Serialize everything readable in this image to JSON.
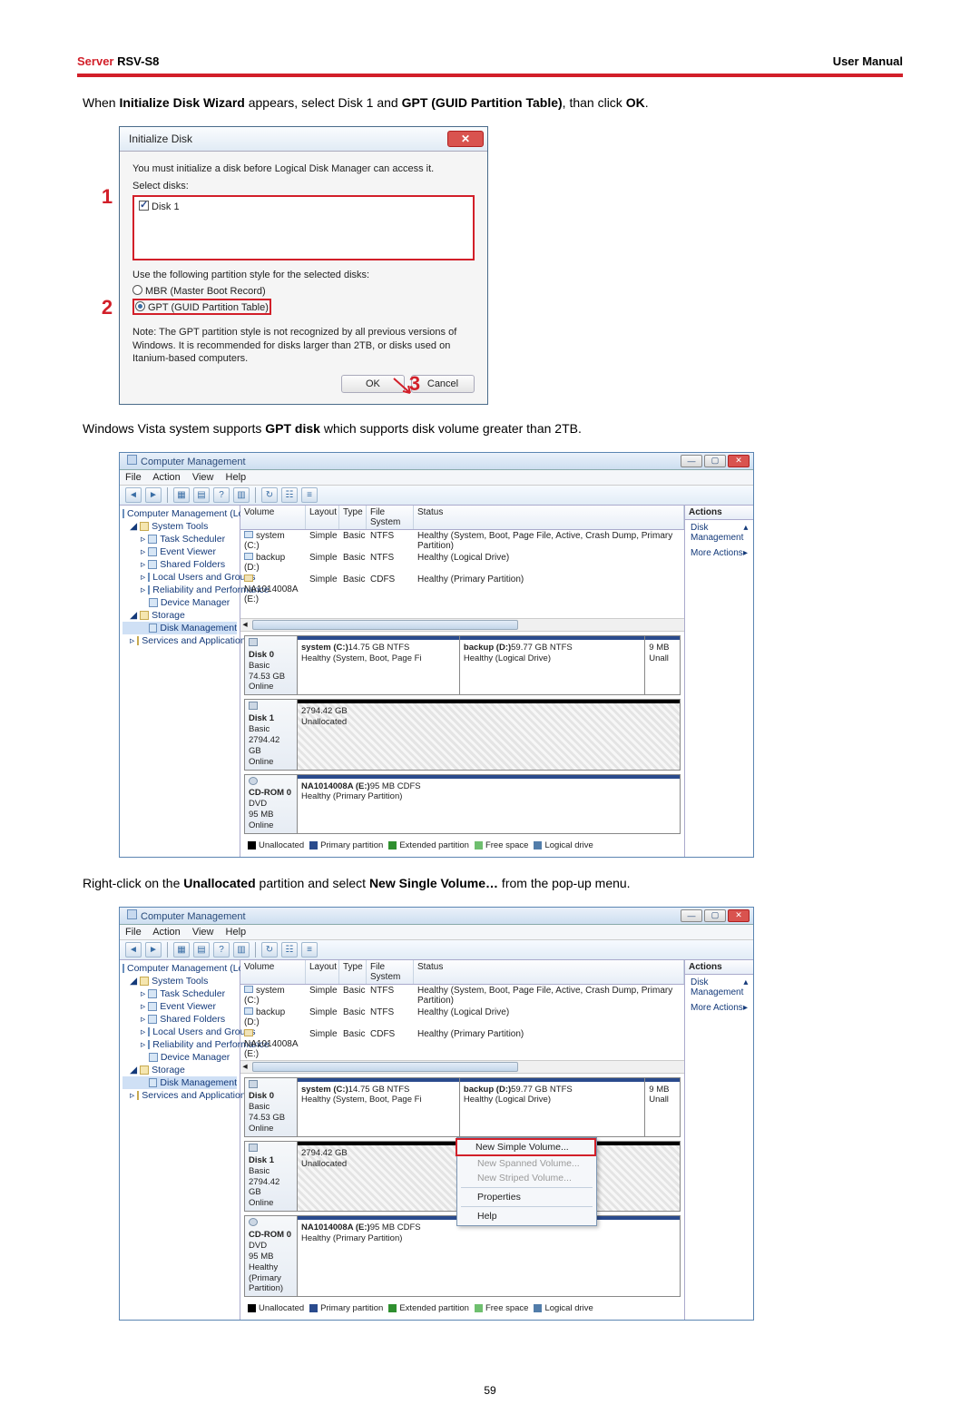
{
  "header": {
    "server": "Server",
    "model": "RSV-S8",
    "right": "User Manual"
  },
  "page_num": "59",
  "para1": {
    "pre": "When ",
    "b1": "Initialize Disk Wizard",
    "mid1": " appears, select Disk 1 and ",
    "b2": "GPT (GUID Partition Table)",
    "mid2": ", than click ",
    "b3": "OK",
    "end": "."
  },
  "dialog": {
    "title": "Initialize Disk",
    "line1": "You must initialize a disk before Logical Disk Manager can access it.",
    "line2": "Select disks:",
    "disk1": "Disk 1",
    "line3": "Use the following partition style for the selected disks:",
    "opt_mbr": "MBR (Master Boot Record)",
    "opt_gpt": "GPT (GUID Partition Table)",
    "note": "Note: The GPT partition style is not recognized by all previous versions of Windows. It is recommended for disks larger than 2TB, or disks used on Itanium-based computers.",
    "ok": "OK",
    "cancel": "Cancel",
    "callouts": {
      "c1": "1",
      "c2": "2",
      "c3": "3"
    }
  },
  "para2": {
    "pre": "Windows Vista system supports ",
    "b1": "GPT disk",
    "post": " which supports disk volume greater than 2TB."
  },
  "para3": {
    "pre": "Right-click on the ",
    "b1": "Unallocated",
    "mid": " partition and select ",
    "b2": "New Single Volume…",
    "post": " from the pop-up menu."
  },
  "mmc": {
    "title": "Computer Management",
    "menu": [
      "File",
      "Action",
      "View",
      "Help"
    ],
    "tree": {
      "root": "Computer Management (Local)",
      "system_tools": "System Tools",
      "items_sys": [
        "Task Scheduler",
        "Event Viewer",
        "Shared Folders",
        "Local Users and Groups",
        "Reliability and Performance",
        "Device Manager"
      ],
      "storage": "Storage",
      "disk_mgmt": "Disk Management",
      "services": "Services and Applications"
    },
    "vol_headers": {
      "volume": "Volume",
      "layout": "Layout",
      "type": "Type",
      "fs": "File System",
      "status": "Status"
    },
    "volumes": [
      {
        "name": "system (C:)",
        "layout": "Simple",
        "type": "Basic",
        "fs": "NTFS",
        "status": "Healthy (System, Boot, Page File, Active, Crash Dump, Primary Partition)"
      },
      {
        "name": "backup (D:)",
        "layout": "Simple",
        "type": "Basic",
        "fs": "NTFS",
        "status": "Healthy (Logical Drive)"
      },
      {
        "name": "NA1014008A (E:)",
        "layout": "Simple",
        "type": "Basic",
        "fs": "CDFS",
        "status": "Healthy (Primary Partition)"
      }
    ],
    "disks": {
      "d0": {
        "label": "Disk 0",
        "kind": "Basic",
        "size": "74.53 GB",
        "state": "Online",
        "p1": {
          "name": "system  (C:)",
          "sz": "14.75 GB NTFS",
          "st": "Healthy (System, Boot, Page Fi"
        },
        "p2": {
          "name": "backup  (D:)",
          "sz": "59.77 GB NTFS",
          "st": "Healthy (Logical Drive)"
        },
        "p3": {
          "sz": "9 MB",
          "st": "Unall"
        }
      },
      "d1": {
        "label": "Disk 1",
        "kind": "Basic",
        "size": "2794.42 GB",
        "state": "Online",
        "p1": {
          "sz": "2794.42 GB",
          "st": "Unallocated"
        }
      },
      "cd": {
        "label": "CD-ROM 0",
        "kind": "DVD",
        "size": "95 MB",
        "state": "Online",
        "p1": {
          "name": "NA1014008A  (E:)",
          "sz": "95 MB CDFS",
          "st": "Healthy (Primary Partition)"
        }
      }
    },
    "legend": {
      "un": "Unallocated",
      "pp": "Primary partition",
      "ep": "Extended partition",
      "fs": "Free space",
      "ld": "Logical drive"
    },
    "actions": {
      "hdr": "Actions",
      "dm": "Disk Management",
      "more": "More Actions"
    }
  },
  "ctx": {
    "i1": "New Simple Volume...",
    "i2": "New Spanned Volume...",
    "i3": "New Striped Volume...",
    "i4": "Properties",
    "i5": "Help"
  }
}
